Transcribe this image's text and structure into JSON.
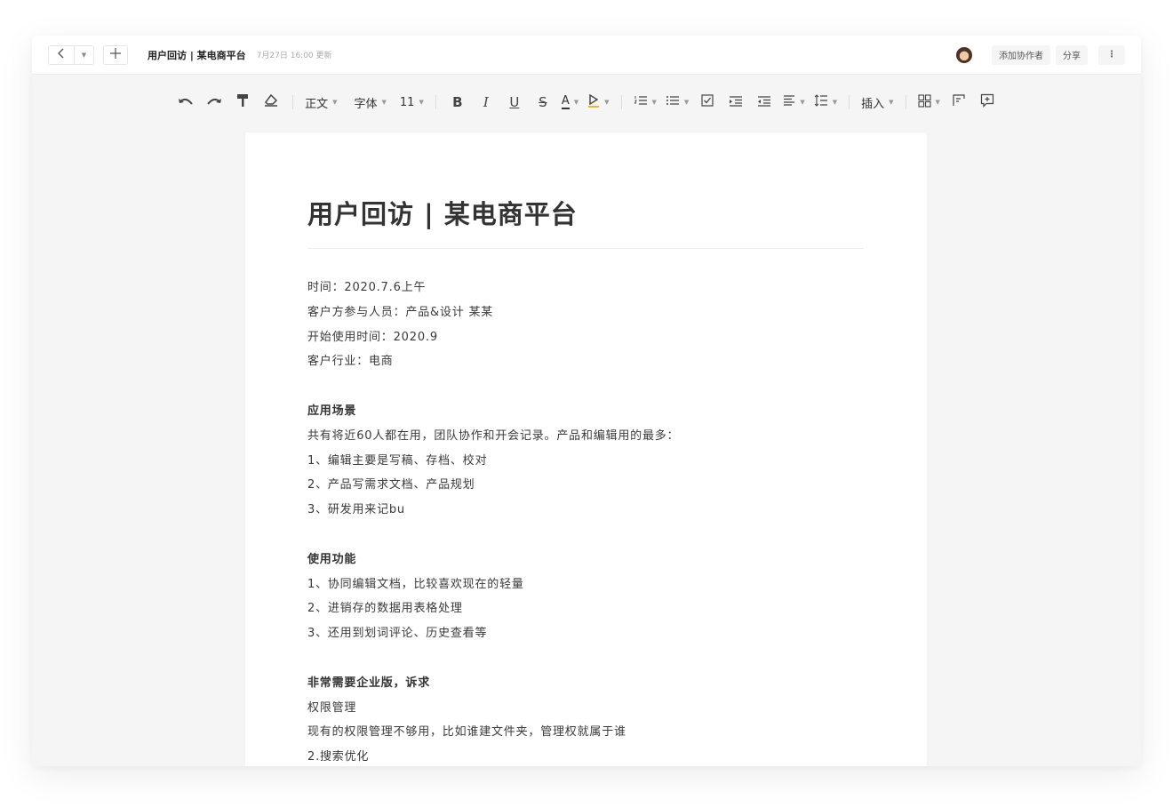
{
  "header": {
    "doc_title": "用户回访 | 某电商平台",
    "updated": "7月27日 16:00 更新",
    "add_collaborator": "添加协作者",
    "share": "分享",
    "more": "⋮"
  },
  "toolbar": {
    "style": "正文",
    "font": "字体",
    "size": "11",
    "bold": "B",
    "italic": "I",
    "underline": "U",
    "strike": "S",
    "color": "A",
    "insert": "插入"
  },
  "doc": {
    "title": "用户回访 | 某电商平台",
    "lines": [
      {
        "text": "时间：2020.7.6上午",
        "bold": false
      },
      {
        "text": "客户方参与人员：产品&设计 某某",
        "bold": false
      },
      {
        "text": "开始使用时间：2020.9",
        "bold": false
      },
      {
        "text": "客户行业：电商",
        "bold": false
      },
      {
        "text": "",
        "bold": false
      },
      {
        "text": "应用场景",
        "bold": true
      },
      {
        "text": "共有将近60人都在用，团队协作和开会记录。产品和编辑用的最多：",
        "bold": false
      },
      {
        "text": "1、编辑主要是写稿、存档、校对",
        "bold": false
      },
      {
        "text": "2、产品写需求文档、产品规划",
        "bold": false
      },
      {
        "text": "3、研发用来记bu",
        "bold": false
      },
      {
        "text": "",
        "bold": false
      },
      {
        "text": "使用功能",
        "bold": true
      },
      {
        "text": "1、协同编辑文档，比较喜欢现在的轻量",
        "bold": false
      },
      {
        "text": "2、进销存的数据用表格处理",
        "bold": false
      },
      {
        "text": "3、还用到划词评论、历史查看等",
        "bold": false
      },
      {
        "text": "",
        "bold": false
      },
      {
        "text": "非常需要企业版，诉求",
        "bold": true
      },
      {
        "text": "权限管理",
        "bold": false
      },
      {
        "text": "现有的权限管理不够用，比如谁建文件夹，管理权就属于谁",
        "bold": false
      },
      {
        "text": "2.搜索优化",
        "bold": false
      }
    ]
  }
}
